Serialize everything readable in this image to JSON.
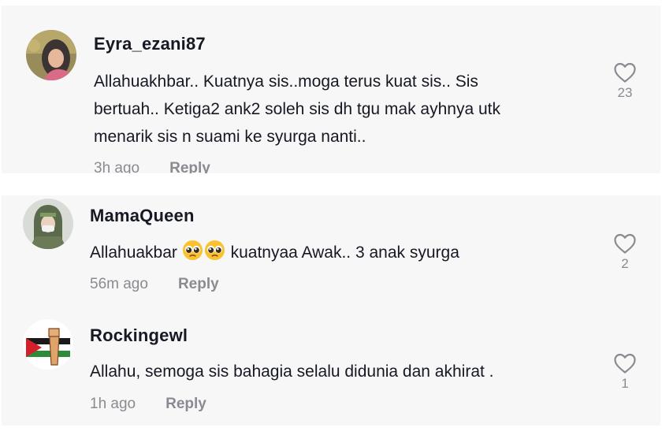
{
  "comments": [
    {
      "username": "Eyra_ezani87",
      "lines": [
        "Allahuakhbar.. Kuatnya sis..moga terus kuat sis.. Sis",
        "bertuah.. Ketiga2 ank2 soleh sis dh tgu mak ayhnya utk",
        "menarik sis n suami ke syurga nanti.."
      ],
      "time": "3h ago",
      "reply": "Reply",
      "likes": "23"
    },
    {
      "username": "MamaQueen",
      "text_before": "Allahuakbar",
      "emoji": "pleading-face",
      "text_after": "kuatnyaa Awak.. 3 anak syurga",
      "time": "56m ago",
      "reply": "Reply",
      "likes": "2"
    },
    {
      "username": "Rockingewl",
      "text": "Allahu, semoga sis bahagia selalu didunia dan akhirat .",
      "time": "1h ago",
      "reply": "Reply",
      "likes": "1"
    }
  ],
  "colors": {
    "card_bg": "#f7f7f8",
    "text": "#161823",
    "muted": "#8a8b91"
  }
}
